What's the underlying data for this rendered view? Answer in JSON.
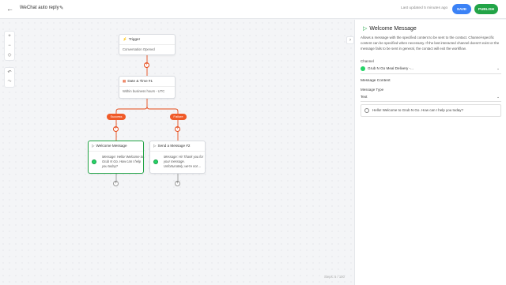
{
  "topbar": {
    "back_icon": "←",
    "title": "WeChat auto reply",
    "edit_icon": "✎",
    "updated": "Last updated 5 minutes ago",
    "save_label": "SAVE",
    "publish_label": "PUBLISH"
  },
  "canvas_tools": {
    "zoom_in": "+",
    "zoom_out": "−",
    "fit": "◇",
    "undo": "↶",
    "redo": "↷"
  },
  "collapse_icon": "›",
  "nodes": {
    "trigger": {
      "title": "Trigger",
      "icon": "⚡",
      "body": "Conversation Opened"
    },
    "datetime": {
      "title": "Date & Time #1",
      "icon": "▦",
      "body": "Within business hours - UTC"
    },
    "success_tag": "Success",
    "failure_tag": "Failure",
    "welcome": {
      "title": "Welcome Message",
      "icon": "▷",
      "body": "Message: Hello! Welcome to Grub N Go. How can I help you today?"
    },
    "send2": {
      "title": "Send a Message #2",
      "icon": "▷",
      "body": "Message: Hi! Thank you for your message. Unfortunately, we're not ..."
    },
    "node_actions": {
      "copy": "⧉",
      "delete": "🗑"
    }
  },
  "steps_counter": "Steps: 5 / 100",
  "panel": {
    "title": "Welcome Message",
    "icon": "▷",
    "description": "Allows a message with the specified content to be sent to the contact. Channel-specific content can be specified when necessary. If the last interacted channel doesn't exist or the message fails to be sent in general, the contact will exit the workflow.",
    "channel_label": "Channel",
    "channel_value": "Grub N Go Meal Delivery -...",
    "section_content": "Message Content",
    "type_label": "Message Type",
    "type_value": "Text",
    "message_text": "Hello! Welcome to Grub N Go. How can I help you today?"
  },
  "colors": {
    "primary": "#3b82f6",
    "publish": "#22a447",
    "accent": "#f05a28"
  }
}
